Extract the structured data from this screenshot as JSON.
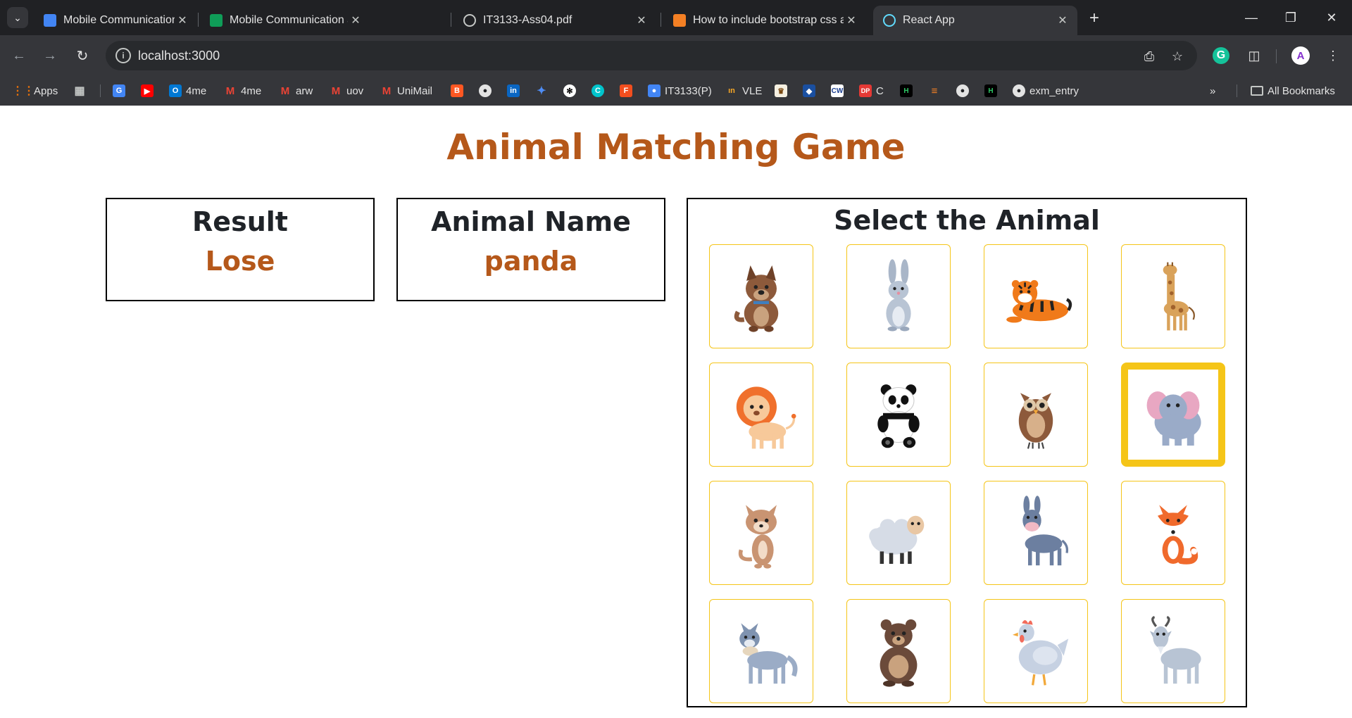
{
  "browser": {
    "tabs": [
      {
        "title": "Mobile Communication and Co",
        "favicon": "google-classroom-icon",
        "color": "#4285f4"
      },
      {
        "title": "Mobile Communication and Co",
        "favicon": "google-sheets-icon",
        "color": "#0f9d58"
      },
      {
        "title": "IT3133-Ass04.pdf",
        "favicon": "globe-icon",
        "color": "#9aa0a6"
      },
      {
        "title": "How to include bootstrap css ar",
        "favicon": "stackoverflow-icon",
        "color": "#f48024"
      },
      {
        "title": "React App",
        "favicon": "react-icon",
        "color": "#61dafb"
      }
    ],
    "url": "localhost:3000",
    "bookmarks": [
      {
        "label": "Apps",
        "icon": "apps-grid-icon"
      },
      {
        "label": "",
        "icon": "tab-groups-icon"
      },
      {
        "label": "",
        "icon": "google-translate-icon"
      },
      {
        "label": "",
        "icon": "youtube-icon"
      },
      {
        "label": "4me",
        "icon": "outlook-icon"
      },
      {
        "label": "4me",
        "icon": "gmail-icon"
      },
      {
        "label": "arw",
        "icon": "gmail-icon"
      },
      {
        "label": "uov",
        "icon": "gmail-icon"
      },
      {
        "label": "UniMail",
        "icon": "gmail-icon"
      },
      {
        "label": "",
        "icon": "blogger-icon"
      },
      {
        "label": "",
        "icon": "github-icon"
      },
      {
        "label": "",
        "icon": "linkedin-icon"
      },
      {
        "label": "",
        "icon": "gemini-icon"
      },
      {
        "label": "",
        "icon": "chatgpt-icon"
      },
      {
        "label": "",
        "icon": "canva-icon"
      },
      {
        "label": "",
        "icon": "figma-icon"
      },
      {
        "label": "IT3133(P)",
        "icon": "google-classroom-icon"
      },
      {
        "label": "VLE",
        "icon": "vle-icon"
      },
      {
        "label": "",
        "icon": "university-crest-icon"
      },
      {
        "label": "",
        "icon": "crest-icon"
      },
      {
        "label": "",
        "icon": "cw-icon"
      },
      {
        "label": "C",
        "icon": "dp-icon"
      },
      {
        "label": "",
        "icon": "hackerrank-icon"
      },
      {
        "label": "",
        "icon": "stackoverflow-icon"
      },
      {
        "label": "",
        "icon": "github-icon"
      },
      {
        "label": "",
        "icon": "hackerrank-icon"
      },
      {
        "label": "exm_entry",
        "icon": "github-icon"
      }
    ],
    "all_bookmarks": "All Bookmarks",
    "profile_initial": "A"
  },
  "game": {
    "title": "Animal Matching Game",
    "result_heading": "Result",
    "result_value": "Lose",
    "animal_heading": "Animal Name",
    "animal_value": "panda",
    "select_heading": "Select the Animal",
    "accent_color": "#b5581a",
    "card_border_color": "#f5c518",
    "selected_index": 7,
    "animals": [
      "dog",
      "rabbit",
      "tiger",
      "giraffe",
      "lion",
      "panda",
      "owl",
      "elephant",
      "cat",
      "sheep",
      "donkey",
      "fox",
      "wolf",
      "bear",
      "hen",
      "goat"
    ]
  }
}
